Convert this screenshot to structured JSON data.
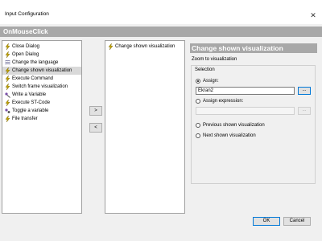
{
  "window": {
    "title": "Input Configuration",
    "close_glyph": "✕"
  },
  "header": {
    "title": "OnMouseClick"
  },
  "available_actions": [
    {
      "label": "Close Dialog",
      "icon": "lightning-icon"
    },
    {
      "label": "Open Dialog",
      "icon": "lightning-icon"
    },
    {
      "label": "Change the language",
      "icon": "language-icon"
    },
    {
      "label": "Change shown visualization",
      "icon": "lightning-icon",
      "selected": true
    },
    {
      "label": "Execute Command",
      "icon": "lightning-icon"
    },
    {
      "label": "Switch frame visualization",
      "icon": "lightning-icon"
    },
    {
      "label": "Write a Variable",
      "icon": "write-variable-icon"
    },
    {
      "label": "Execute ST-Code",
      "icon": "lightning-icon"
    },
    {
      "label": "Toggle a variable",
      "icon": "toggle-variable-icon"
    },
    {
      "label": "File transfer",
      "icon": "lightning-icon"
    }
  ],
  "configured_actions": [
    {
      "label": "Change shown visualization",
      "icon": "lightning-icon"
    }
  ],
  "move_buttons": {
    "add": ">",
    "remove": "<"
  },
  "properties": {
    "title": "Change shown visualization",
    "zoom_label": "Zoom to visualization",
    "group_label": "Selection",
    "assign": {
      "label": "Assign:",
      "value": "Ekran2",
      "button": "..."
    },
    "assign_expression": {
      "label": "Assign expression:",
      "value": "",
      "button": "..."
    },
    "previous": {
      "label": "Previous shown visualization"
    },
    "next": {
      "label": "Next shown visualization"
    }
  },
  "footer": {
    "ok": "OK",
    "cancel": "Cancel"
  },
  "colors": {
    "header_bar": "#a8a8a8",
    "selection": "#d9d9d9",
    "lightning": "#c9a800",
    "focus_border": "#0078d7"
  }
}
